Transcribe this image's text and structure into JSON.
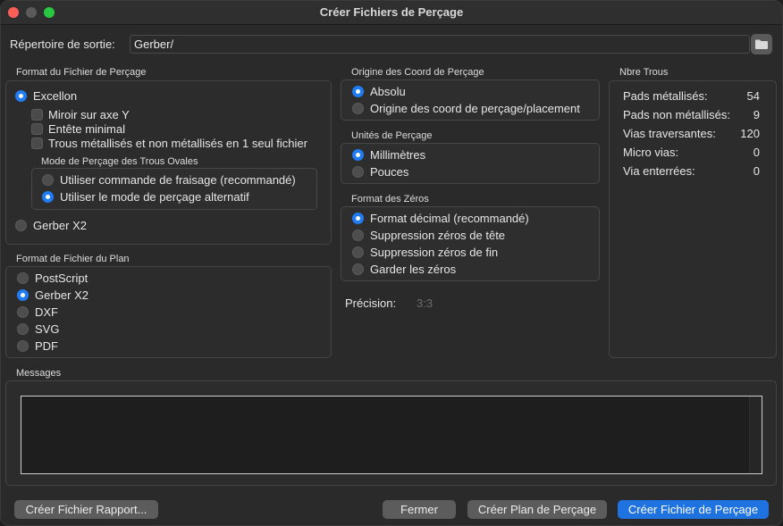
{
  "window": {
    "title": "Créer Fichiers de Perçage"
  },
  "output": {
    "label": "Répertoire de sortie:",
    "value": "Gerber/"
  },
  "drill_format": {
    "title": "Format du Fichier de Perçage",
    "excellon": "Excellon",
    "mirror": "Miroir sur axe Y",
    "minimal_header": "Entête minimal",
    "merge_pth": "Trous métallisés et non métallisés en 1 seul fichier",
    "oval_title": "Mode de Perçage des Trous Ovales",
    "oval_route": "Utiliser commande de fraisage (recommandé)",
    "oval_alt": "Utiliser le mode de perçage alternatif",
    "gerber": "Gerber X2"
  },
  "map_format": {
    "title": "Format de Fichier du Plan",
    "options": [
      "PostScript",
      "Gerber X2",
      "DXF",
      "SVG",
      "PDF"
    ],
    "selected": "Gerber X2"
  },
  "origin": {
    "title": "Origine des Coord de Perçage",
    "absolute": "Absolu",
    "aux": "Origine des coord de perçage/placement",
    "selected": "Absolu"
  },
  "units": {
    "title": "Unités de Perçage",
    "mm": "Millimètres",
    "inch": "Pouces",
    "selected": "Millimètres"
  },
  "zeros": {
    "title": "Format des Zéros",
    "decimal": "Format décimal (recommandé)",
    "suppress_leading": "Suppression zéros de tête",
    "suppress_trailing": "Suppression zéros de fin",
    "keep": "Garder les zéros",
    "selected": "Format décimal (recommandé)"
  },
  "precision": {
    "label": "Précision:",
    "value": "3:3"
  },
  "holes": {
    "title": "Nbre Trous",
    "rows": [
      {
        "name": "Pads métallisés:",
        "value": "54"
      },
      {
        "name": "Pads non métallisés:",
        "value": "9"
      },
      {
        "name": "Vias traversantes:",
        "value": "120"
      },
      {
        "name": "Micro vias:",
        "value": "0"
      },
      {
        "name": "Via enterrées:",
        "value": "0"
      }
    ]
  },
  "messages": {
    "title": "Messages"
  },
  "buttons": {
    "report": "Créer Fichier Rapport...",
    "close": "Fermer",
    "map": "Créer Plan de Perçage",
    "drill": "Créer Fichier de Perçage"
  },
  "colors": {
    "accent": "#1f7cf4",
    "primary_button": "#1f73e0"
  },
  "icons": {
    "folder": "folder-icon"
  }
}
